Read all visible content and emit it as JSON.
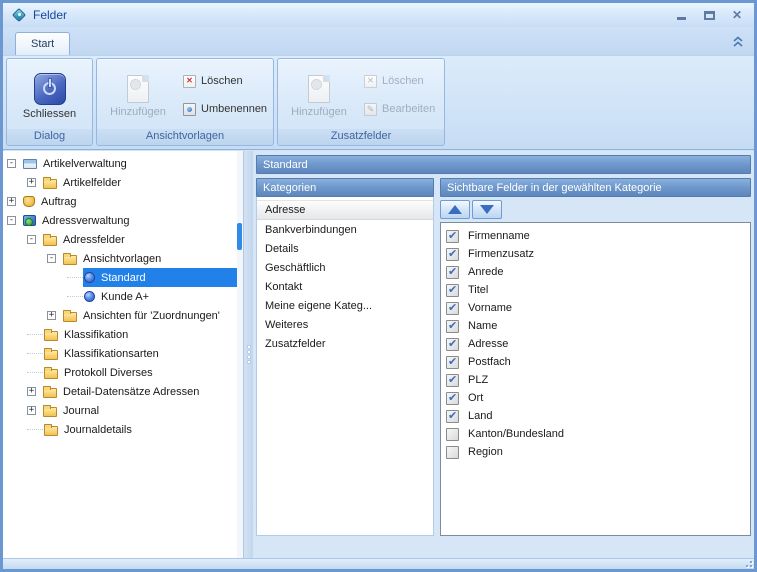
{
  "window": {
    "title": "Felder"
  },
  "ribbon": {
    "tabs": [
      {
        "label": "Start",
        "active": true
      }
    ],
    "groups": [
      {
        "name": "dialog",
        "label": "Dialog",
        "big": [
          {
            "name": "schliessen",
            "label": "Schliessen",
            "icon": "power-icon",
            "enabled": true
          }
        ],
        "small": []
      },
      {
        "name": "ansichtvorlagen",
        "label": "Ansichtvorlagen",
        "big": [
          {
            "name": "hinzufuegen-ansichtvorlage",
            "label": "Hinzufügen",
            "icon": "page-add-icon",
            "enabled": false
          }
        ],
        "small": [
          {
            "name": "loeschen-ansichtvorlage",
            "label": "Löschen",
            "icon": "delete-icon",
            "enabled": true
          },
          {
            "name": "umbenennen-ansichtvorlage",
            "label": "Umbenennen",
            "icon": "rename-icon",
            "enabled": true
          }
        ]
      },
      {
        "name": "zusatzfelder",
        "label": "Zusatzfelder",
        "big": [
          {
            "name": "hinzufuegen-zusatzfeld",
            "label": "Hinzufügen",
            "icon": "page-add-icon",
            "enabled": false
          }
        ],
        "small": [
          {
            "name": "loeschen-zusatzfeld",
            "label": "Löschen",
            "icon": "delete-icon",
            "enabled": false
          },
          {
            "name": "bearbeiten-zusatzfeld",
            "label": "Bearbeiten",
            "icon": "edit-icon",
            "enabled": false
          }
        ]
      }
    ]
  },
  "tree": {
    "items": [
      {
        "label": "Artikelverwaltung",
        "level": 0,
        "expander": "minus",
        "icon": "card-icon",
        "selected": false
      },
      {
        "label": "Artikelfelder",
        "level": 1,
        "expander": "plus",
        "icon": "folder-icon",
        "selected": false
      },
      {
        "label": "Auftrag",
        "level": 0,
        "expander": "plus",
        "icon": "bag-icon",
        "selected": false
      },
      {
        "label": "Adressverwaltung",
        "level": 0,
        "expander": "minus",
        "icon": "addressbook-icon",
        "selected": false
      },
      {
        "label": "Adressfelder",
        "level": 1,
        "expander": "minus",
        "icon": "folder-icon",
        "selected": false
      },
      {
        "label": "Ansichtvorlagen",
        "level": 2,
        "expander": "minus",
        "icon": "folder-icon",
        "selected": false
      },
      {
        "label": "Standard",
        "level": 3,
        "expander": "none",
        "icon": "sphere-icon",
        "selected": true
      },
      {
        "label": "Kunde A+",
        "level": 3,
        "expander": "none",
        "icon": "sphere-icon",
        "selected": false
      },
      {
        "label": "Ansichten für 'Zuordnungen'",
        "level": 2,
        "expander": "plus",
        "icon": "folder-icon",
        "selected": false
      },
      {
        "label": "Klassifikation",
        "level": 1,
        "expander": "none",
        "icon": "folder-icon",
        "selected": false
      },
      {
        "label": "Klassifikationsarten",
        "level": 1,
        "expander": "none",
        "icon": "folder-icon",
        "selected": false
      },
      {
        "label": "Protokoll Diverses",
        "level": 1,
        "expander": "none",
        "icon": "folder-icon",
        "selected": false
      },
      {
        "label": "Detail-Datensätze Adressen",
        "level": 1,
        "expander": "plus",
        "icon": "folder-icon",
        "selected": false
      },
      {
        "label": "Journal",
        "level": 1,
        "expander": "plus",
        "icon": "folder-icon",
        "selected": false
      },
      {
        "label": "Journaldetails",
        "level": 1,
        "expander": "none",
        "icon": "folder-icon",
        "selected": false
      }
    ]
  },
  "content": {
    "header": "Standard",
    "categories": {
      "header": "Kategorien",
      "items": [
        {
          "label": "Adresse",
          "selected": true
        },
        {
          "label": "Bankverbindungen",
          "selected": false
        },
        {
          "label": "Details",
          "selected": false
        },
        {
          "label": "Geschäftlich",
          "selected": false
        },
        {
          "label": "Kontakt",
          "selected": false
        },
        {
          "label": "Meine eigene Kateg...",
          "selected": false
        },
        {
          "label": "Weiteres",
          "selected": false
        },
        {
          "label": "Zusatzfelder",
          "selected": false
        }
      ]
    },
    "fields": {
      "header": "Sichtbare Felder in der gewählten Kategorie",
      "items": [
        {
          "label": "Firmenname",
          "checked": true
        },
        {
          "label": "Firmenzusatz",
          "checked": true
        },
        {
          "label": "Anrede",
          "checked": true
        },
        {
          "label": "Titel",
          "checked": true
        },
        {
          "label": "Vorname",
          "checked": true
        },
        {
          "label": "Name",
          "checked": true
        },
        {
          "label": "Adresse",
          "checked": true
        },
        {
          "label": "Postfach",
          "checked": true
        },
        {
          "label": "PLZ",
          "checked": true
        },
        {
          "label": "Ort",
          "checked": true
        },
        {
          "label": "Land",
          "checked": true
        },
        {
          "label": "Kanton/Bundesland",
          "checked": false
        },
        {
          "label": "Region",
          "checked": false
        }
      ]
    }
  },
  "colors": {
    "accent_selection": "#2281e9",
    "panel_header": "#6e97cc",
    "title_text": "#15489c",
    "ribbon_caption_text": "#3e65a0"
  }
}
